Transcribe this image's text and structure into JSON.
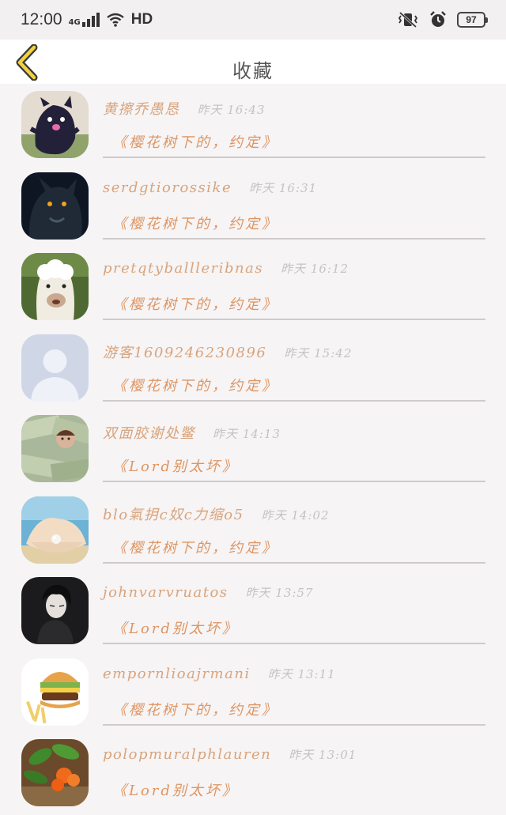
{
  "status": {
    "time": "12:00",
    "net": "4G",
    "hd": "HD",
    "battery": "97"
  },
  "header": {
    "title": "收藏"
  },
  "items": [
    {
      "name": "黄擦乔愚恳",
      "time": "昨天 16:43",
      "msg": "《樱花树下的，约定》"
    },
    {
      "name": "serdgtiorossike",
      "time": "昨天 16:31",
      "msg": "《樱花树下的，约定》"
    },
    {
      "name": "pretqtyballleribnas",
      "time": "昨天 16:12",
      "msg": "《樱花树下的，约定》"
    },
    {
      "name": "游客1609246230896",
      "time": "昨天 15:42",
      "msg": "《樱花树下的，约定》"
    },
    {
      "name": "双面胶谢处鳖",
      "time": "昨天 14:13",
      "msg": "《Lord别太坏》"
    },
    {
      "name": "blo氣抈c奴c力缩o5",
      "time": "昨天 14:02",
      "msg": "《樱花树下的，约定》"
    },
    {
      "name": "johnvarvruatos",
      "time": "昨天 13:57",
      "msg": "《Lord别太坏》"
    },
    {
      "name": "empornlioajrmani",
      "time": "昨天 13:11",
      "msg": "《樱花树下的，约定》"
    },
    {
      "name": "polopmuralphlauren",
      "time": "昨天 13:01",
      "msg": "《Lord别太坏》"
    }
  ]
}
